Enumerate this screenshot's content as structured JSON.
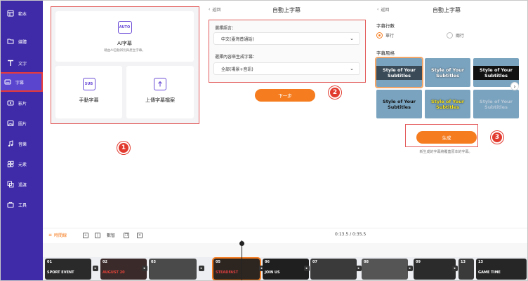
{
  "sidebar": {
    "items": [
      {
        "label": "範本",
        "icon": "template-icon"
      },
      {
        "label": "媒體",
        "icon": "media-icon"
      },
      {
        "label": "文字",
        "icon": "text-icon"
      },
      {
        "label": "字幕",
        "icon": "subtitle-icon",
        "active": true
      },
      {
        "label": "影片",
        "icon": "video-icon"
      },
      {
        "label": "圖片",
        "icon": "image-icon"
      },
      {
        "label": "音樂",
        "icon": "music-icon"
      },
      {
        "label": "元素",
        "icon": "elements-icon"
      },
      {
        "label": "過渡",
        "icon": "transition-icon"
      },
      {
        "label": "工具",
        "icon": "tools-icon"
      }
    ],
    "bg_color": "#3f2aa8"
  },
  "panel1": {
    "ai": {
      "icon_text": "AUTO",
      "title": "AI字幕",
      "subtitle": "藉由AI自動辨別與產生字幕。"
    },
    "manual": {
      "icon_text": "SUB",
      "title": "手動字幕"
    },
    "upload": {
      "title": "上傳字幕檔案"
    }
  },
  "panel2": {
    "back": "返回",
    "title": "自動上字幕",
    "language_label": "選擇語言：",
    "language_value": "中文(臺灣普通話)",
    "content_label": "選擇內容來生成字幕：",
    "content_value": "全部(場景+音訊)",
    "next_button": "下一步"
  },
  "panel3": {
    "back": "返回",
    "title": "自動上字幕",
    "rows_label": "字幕行數",
    "options": [
      "單行",
      "兩行"
    ],
    "selected_option": "單行",
    "style_label": "字幕風格",
    "styles": [
      "Style of Your Subtitles",
      "Style of Your Subtitles",
      "Style of Your Subtitles",
      "Style of Your Subtitles",
      "Style of Your Subtitles",
      "Style of Your Subtitles"
    ],
    "generate_button": "生成",
    "note": "新生成的字幕將覆蓋原本的字幕。"
  },
  "markers": {
    "one": "1",
    "two": "2",
    "three": "3"
  },
  "timeline": {
    "timeline_label": "時間線",
    "aspect_label": "數智",
    "time": "0:13.5 / 0:35.5",
    "clips": [
      {
        "num": "01",
        "caption": "SPORT EVENT"
      },
      {
        "num": "02",
        "caption": "AUGUST 20"
      },
      {
        "num": "03",
        "caption": ""
      },
      {
        "num": "05",
        "caption": "STEADFAST"
      },
      {
        "num": "06",
        "caption": "JOIN US"
      },
      {
        "num": "07",
        "caption": ""
      },
      {
        "num": "08",
        "caption": ""
      },
      {
        "num": "09",
        "caption": ""
      },
      {
        "num": "10",
        "caption": ""
      },
      {
        "num": "11",
        "caption": ""
      },
      {
        "num": "12",
        "caption": ""
      },
      {
        "num": "13",
        "caption": "GAME TIME"
      }
    ]
  },
  "colors": {
    "accent": "#f57c1f",
    "highlight": "#e35b5b",
    "marker": "#e23a2e"
  }
}
